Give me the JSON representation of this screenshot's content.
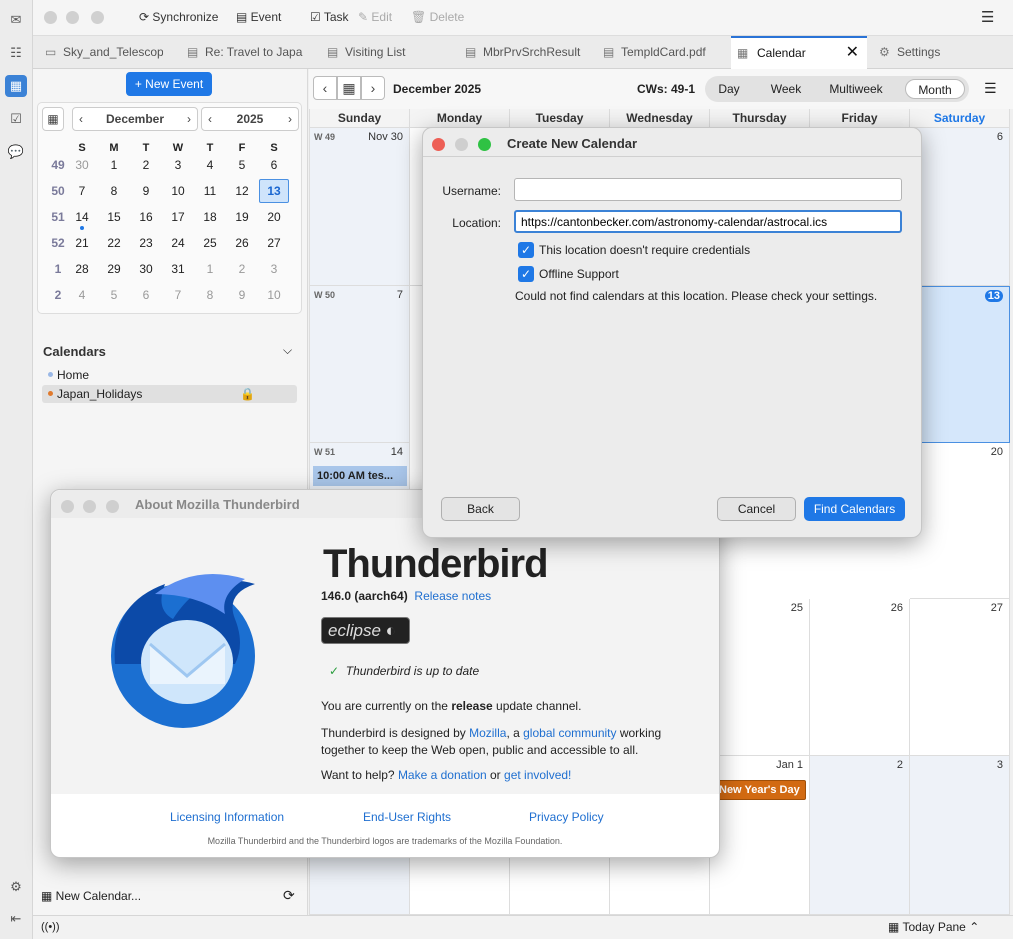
{
  "spaces": [
    "mail-icon",
    "address-book-icon",
    "calendar-icon",
    "tasks-icon",
    "chat-icon",
    "settings-icon",
    "collapse-icon"
  ],
  "toolbar": {
    "synchronize": "Synchronize",
    "event": "Event",
    "task": "Task",
    "edit": "Edit",
    "delete": "Delete"
  },
  "tabs": [
    {
      "label": "Sky_and_Telescope"
    },
    {
      "label": "Re: Travel to Japan"
    },
    {
      "label": "Visiting List"
    },
    {
      "label": "MbrPrvSrchResult"
    },
    {
      "label": "TempldCard.pdf"
    },
    {
      "label": "Calendar"
    },
    {
      "label": "Settings"
    }
  ],
  "left": {
    "new_event": "+ New Event",
    "month": "December",
    "year": "2025",
    "weekday_heads": [
      "S",
      "M",
      "T",
      "W",
      "T",
      "F",
      "S"
    ],
    "weeks": [
      {
        "wk": "49",
        "days": [
          "30",
          "1",
          "2",
          "3",
          "4",
          "5",
          "6"
        ]
      },
      {
        "wk": "50",
        "days": [
          "7",
          "8",
          "9",
          "10",
          "11",
          "12",
          "13"
        ]
      },
      {
        "wk": "51",
        "days": [
          "14",
          "15",
          "16",
          "17",
          "18",
          "19",
          "20"
        ]
      },
      {
        "wk": "52",
        "days": [
          "21",
          "22",
          "23",
          "24",
          "25",
          "26",
          "27"
        ]
      },
      {
        "wk": "1",
        "days": [
          "28",
          "29",
          "30",
          "31",
          "1",
          "2",
          "3"
        ]
      },
      {
        "wk": "2",
        "days": [
          "4",
          "5",
          "6",
          "7",
          "8",
          "9",
          "10"
        ]
      }
    ],
    "calendars_heading": "Calendars",
    "calendars": [
      {
        "name": "Home",
        "color": "#9ab8e6"
      },
      {
        "name": "Japan_Holidays",
        "color": "#e07a2e"
      }
    ],
    "new_calendar": "New Calendar..."
  },
  "main": {
    "title": "December 2025",
    "cws": "CWs: 49-1",
    "views": [
      "Day",
      "Week",
      "Multiweek",
      "Month"
    ],
    "active_view": "Month",
    "day_heads": [
      "Sunday",
      "Monday",
      "Tuesday",
      "Wednesday",
      "Thursday",
      "Friday",
      "Saturday"
    ],
    "cells": {
      "nov30": "Nov 30",
      "w49": "W 49",
      "d6": "6",
      "w50": "W 50",
      "d7": "7",
      "d13": "13",
      "w51": "W 51",
      "d14": "14",
      "d20": "20",
      "d25": "25",
      "d26": "26",
      "d27": "27",
      "jan1": "Jan 1",
      "d2": "2",
      "d3": "3"
    },
    "event_time": "10:00 AM tes...",
    "holiday": "New Year's Day"
  },
  "status": {
    "today_pane": "Today Pane"
  },
  "create_dialog": {
    "title": "Create New Calendar",
    "username_label": "Username:",
    "username_value": "",
    "location_label": "Location:",
    "location_value": "https://cantonbecker.com/astronomy-calendar/astrocal.ics",
    "no_credentials": "This location doesn't require credentials",
    "offline": "Offline Support",
    "error": "Could not find calendars at this location. Please check your settings.",
    "back": "Back",
    "cancel": "Cancel",
    "find": "Find Calendars"
  },
  "about_dialog": {
    "title": "About Mozilla Thunderbird",
    "product": "Thunderbird",
    "version": "146.0 (aarch64)",
    "release_notes": "Release notes",
    "codename": "eclipse",
    "up_to_date": "Thunderbird is up to date",
    "channel_pre": "You are currently on the ",
    "channel": "release",
    "channel_post": " update channel.",
    "designed_pre": "Thunderbird is designed by ",
    "mozilla": "Mozilla",
    "comma": ", a ",
    "community": "global community",
    "designed_post": " working together to keep the Web open, public and accessible to all.",
    "help_pre": "Want to help? ",
    "donation": "Make a donation",
    "or": " or ",
    "involved": "get involved!",
    "licensing": "Licensing Information",
    "eula": "End-User Rights",
    "privacy": "Privacy Policy",
    "trademark": "Mozilla Thunderbird and the Thunderbird logos are trademarks of the Mozilla Foundation."
  }
}
